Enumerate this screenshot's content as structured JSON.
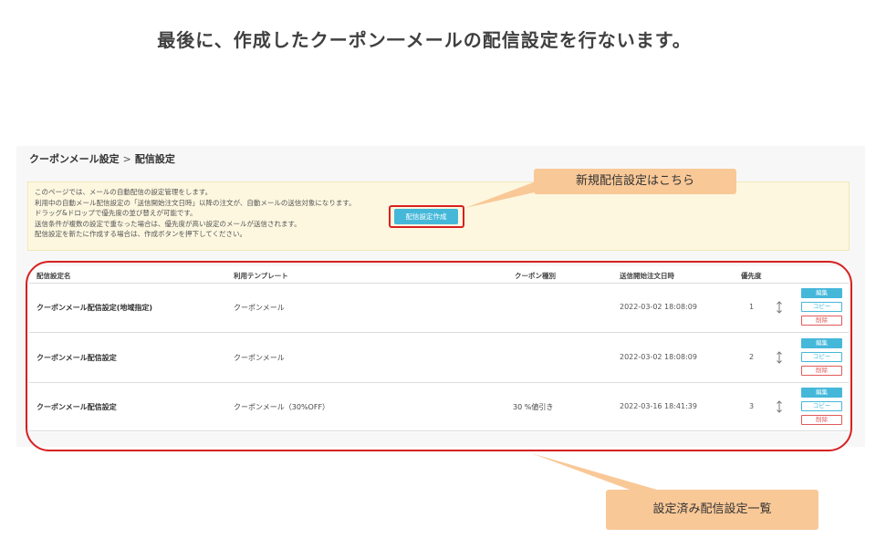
{
  "slide": {
    "title": "最後に、作成したクーポン一メールの配信設定を行ないます。"
  },
  "breadcrumb": {
    "parent": "クーポンメール設定",
    "separator": ">",
    "current": "配信設定"
  },
  "info": {
    "lines": [
      "このページでは、メールの自動配信の設定管理をします。",
      "利用中の自動メール配信設定の「送信開始注文日時」以降の注文が、自動メールの送信対象になります。",
      "ドラッグ&ドロップで優先度の並び替えが可能です。",
      "送信条件が複数の設定で重なった場合は、優先度が高い設定のメールが送信されます。",
      "配信設定を新たに作成する場合は、作成ボタンを押下してください。"
    ],
    "create_button_label": "配信設定作成"
  },
  "callouts": {
    "create": "新規配信設定はこちら",
    "list": "設定済み配信設定一覧"
  },
  "table": {
    "headers": {
      "name": "配信設定名",
      "template": "利用テンプレート",
      "coupon_type": "クーポン種別",
      "start_date": "送信開始注文日時",
      "priority": "優先度"
    },
    "rows": [
      {
        "name": "クーポンメール配信設定(地域指定)",
        "template": "クーポンメール",
        "coupon_type": "",
        "start_date": "2022-03-02 18:08:09",
        "priority": "1"
      },
      {
        "name": "クーポンメール配信設定",
        "template": "クーポンメール",
        "coupon_type": "",
        "start_date": "2022-03-02 18:08:09",
        "priority": "2"
      },
      {
        "name": "クーポンメール配信設定",
        "template": "クーポンメール（30%OFF）",
        "coupon_type": "30 %値引き",
        "start_date": "2022-03-16 18:41:39",
        "priority": "3"
      }
    ],
    "actions": {
      "edit": "編集",
      "copy": "コピー",
      "delete": "削除"
    }
  },
  "colors": {
    "accent": "#45b8da",
    "highlight_ring": "#d82020",
    "callout": "#f9c897",
    "info_bg": "#fdf7e0",
    "delete": "#e05a5a"
  },
  "icons": {
    "drag": "drag-handle-icon"
  }
}
